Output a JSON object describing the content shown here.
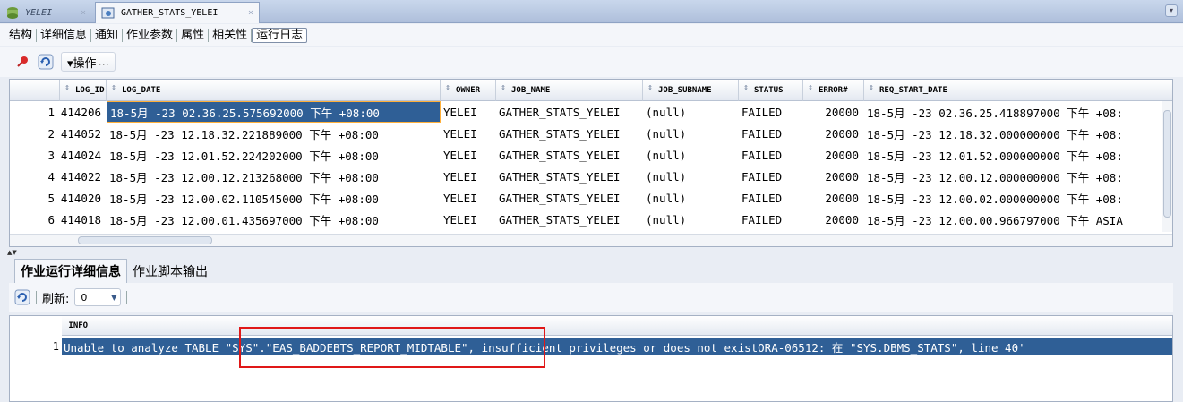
{
  "tabs": [
    {
      "label": "YELEI"
    },
    {
      "label": "GATHER_STATS_YELEI"
    }
  ],
  "subtabs": [
    "结构",
    "详细信息",
    "通知",
    "作业参数",
    "属性",
    "相关性",
    "运行日志"
  ],
  "toolbar": {
    "actions_label": "▾操作",
    "actions_ellipsis": "..."
  },
  "grid": {
    "columns": [
      "LOG_ID",
      "LOG_DATE",
      "OWNER",
      "JOB_NAME",
      "JOB_SUBNAME",
      "STATUS",
      "ERROR#",
      "REQ_START_DATE"
    ],
    "rows": [
      {
        "n": "1",
        "log_id": "414206",
        "log_date": "18-5月 -23 02.36.25.575692000 下午 +08:00",
        "owner": "YELEI",
        "job_name": "GATHER_STATS_YELEI",
        "job_subname": "(null)",
        "status": "FAILED",
        "error": "20000",
        "req_start": "18-5月 -23 02.36.25.418897000 下午 +08:"
      },
      {
        "n": "2",
        "log_id": "414052",
        "log_date": "18-5月 -23 12.18.32.221889000 下午 +08:00",
        "owner": "YELEI",
        "job_name": "GATHER_STATS_YELEI",
        "job_subname": "(null)",
        "status": "FAILED",
        "error": "20000",
        "req_start": "18-5月 -23 12.18.32.000000000 下午 +08:"
      },
      {
        "n": "3",
        "log_id": "414024",
        "log_date": "18-5月 -23 12.01.52.224202000 下午 +08:00",
        "owner": "YELEI",
        "job_name": "GATHER_STATS_YELEI",
        "job_subname": "(null)",
        "status": "FAILED",
        "error": "20000",
        "req_start": "18-5月 -23 12.01.52.000000000 下午 +08:"
      },
      {
        "n": "4",
        "log_id": "414022",
        "log_date": "18-5月 -23 12.00.12.213268000 下午 +08:00",
        "owner": "YELEI",
        "job_name": "GATHER_STATS_YELEI",
        "job_subname": "(null)",
        "status": "FAILED",
        "error": "20000",
        "req_start": "18-5月 -23 12.00.12.000000000 下午 +08:"
      },
      {
        "n": "5",
        "log_id": "414020",
        "log_date": "18-5月 -23 12.00.02.110545000 下午 +08:00",
        "owner": "YELEI",
        "job_name": "GATHER_STATS_YELEI",
        "job_subname": "(null)",
        "status": "FAILED",
        "error": "20000",
        "req_start": "18-5月 -23 12.00.02.000000000 下午 +08:"
      },
      {
        "n": "6",
        "log_id": "414018",
        "log_date": "18-5月 -23 12.00.01.435697000 下午 +08:00",
        "owner": "YELEI",
        "job_name": "GATHER_STATS_YELEI",
        "job_subname": "(null)",
        "status": "FAILED",
        "error": "20000",
        "req_start": "18-5月 -23 12.00.00.966797000 下午 ASIA"
      }
    ]
  },
  "bottom_tabs": [
    "作业运行详细信息",
    "作业脚本输出"
  ],
  "refresh": {
    "label": "刷新:",
    "value": "0"
  },
  "detail": {
    "column": "_INFO",
    "row_num": "1",
    "row_text": "Unable to analyze TABLE \"SYS\".\"EAS_BADDEBTS_REPORT_MIDTABLE\", insufficient privileges or does not existORA-06512: 在 \"SYS.DBMS_STATS\", line 40'"
  },
  "colors": {
    "selection": "#2f5f96",
    "highlight_border": "#e01818"
  }
}
